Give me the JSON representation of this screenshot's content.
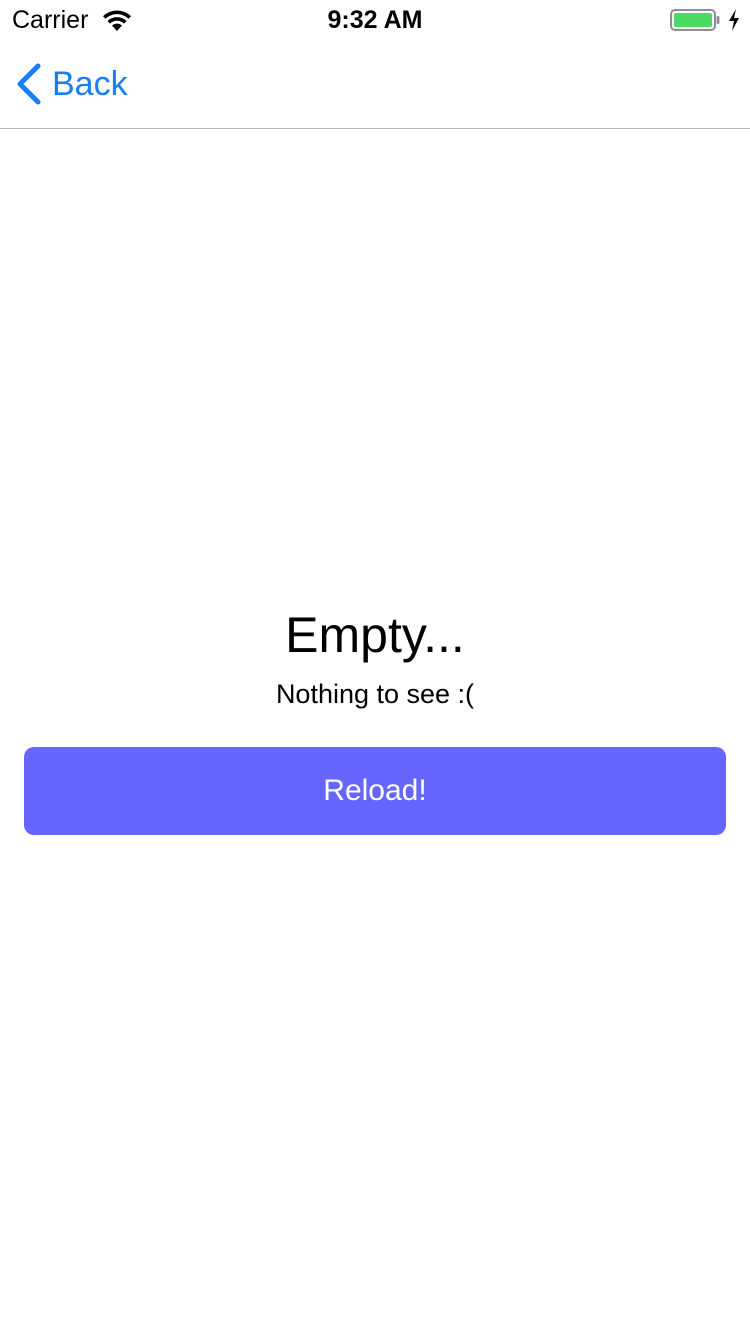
{
  "status_bar": {
    "carrier": "Carrier",
    "time": "9:32 AM",
    "wifi_icon": "wifi-icon",
    "battery_icon": "battery-icon",
    "charging_icon": "charging-bolt-icon",
    "battery_level": 1.0,
    "battery_color": "#4cd964"
  },
  "nav": {
    "back_label": "Back",
    "back_icon": "chevron-left-icon",
    "tint_color": "#157efb"
  },
  "empty_state": {
    "title": "Empty...",
    "subtitle": "Nothing to see :(",
    "reload_label": "Reload!",
    "button_color": "#6666ff"
  }
}
